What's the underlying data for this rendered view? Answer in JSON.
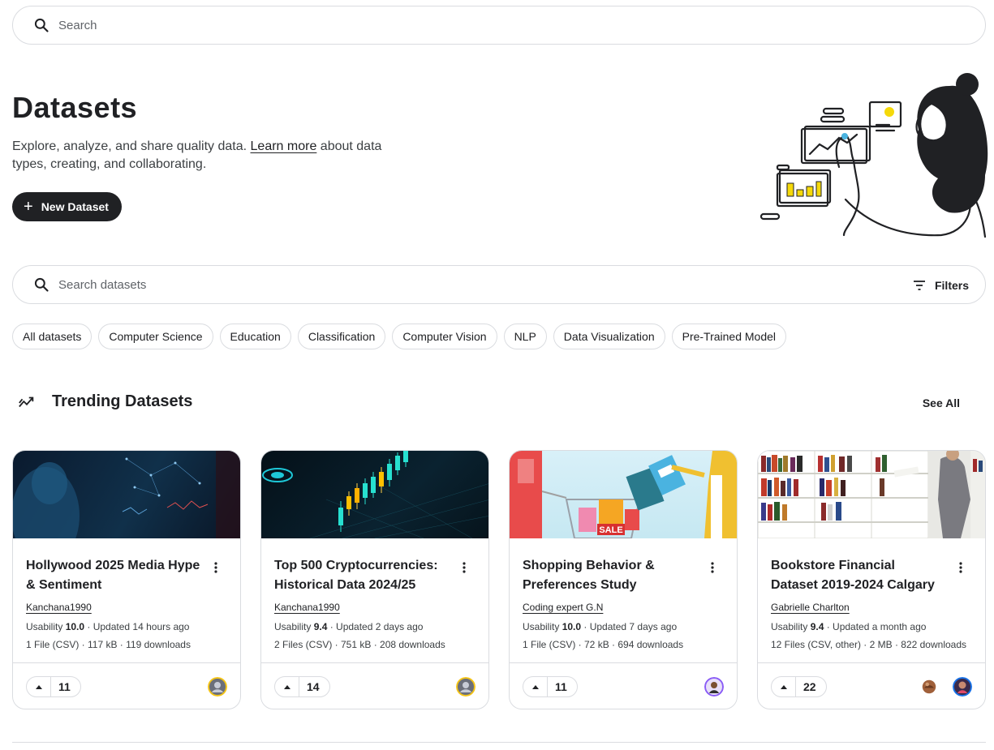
{
  "top_search": {
    "placeholder": "Search"
  },
  "hero": {
    "title": "Datasets",
    "desc_before": "Explore, analyze, and share quality data. ",
    "learn_more": "Learn more",
    "desc_after": " about data types, creating, and collaborating.",
    "new_button": "New Dataset"
  },
  "dataset_search": {
    "placeholder": "Search datasets",
    "filters_label": "Filters"
  },
  "chips": [
    "All datasets",
    "Computer Science",
    "Education",
    "Classification",
    "Computer Vision",
    "NLP",
    "Data Visualization",
    "Pre-Trained Model"
  ],
  "trending": {
    "title": "Trending Datasets",
    "see_all": "See All"
  },
  "cards": [
    {
      "title": "Hollywood 2025 Media Hype & Sentiment",
      "author": "Kanchana1990",
      "usability_label": "Usability ",
      "usability": "10.0",
      "updated": " · Updated 14 hours ago",
      "files": "1 File (CSV) · 117 kB · 119 downloads",
      "votes": "11"
    },
    {
      "title": "Top 500 Cryptocurrencies: Historical Data 2024/25",
      "author": "Kanchana1990",
      "usability_label": "Usability ",
      "usability": "9.4",
      "updated": " · Updated 2 days ago",
      "files": "2 Files (CSV) · 751 kB · 208 downloads",
      "votes": "14"
    },
    {
      "title": "Shopping Behavior & Preferences Study",
      "author": "Coding expert G.N",
      "usability_label": "Usability ",
      "usability": "10.0",
      "updated": " · Updated 7 days ago",
      "files": "1 File (CSV) · 72 kB · 694 downloads",
      "votes": "11"
    },
    {
      "title": "Bookstore Financial Dataset 2019-2024 Calgary",
      "author": "Gabrielle Charlton",
      "usability_label": "Usability ",
      "usability": "9.4",
      "updated": " · Updated a month ago",
      "files": "12 Files (CSV, other) · 2 MB · 822 downloads",
      "votes": "22"
    }
  ],
  "thumb_sale_text": "SALE",
  "colors": {
    "accent_dark": "#202124",
    "border": "#dadce0",
    "avatar_ring_gold": "#f5c518",
    "avatar_ring_purple": "#8a5cf6",
    "avatar_ring_blue": "#1a73e8"
  }
}
